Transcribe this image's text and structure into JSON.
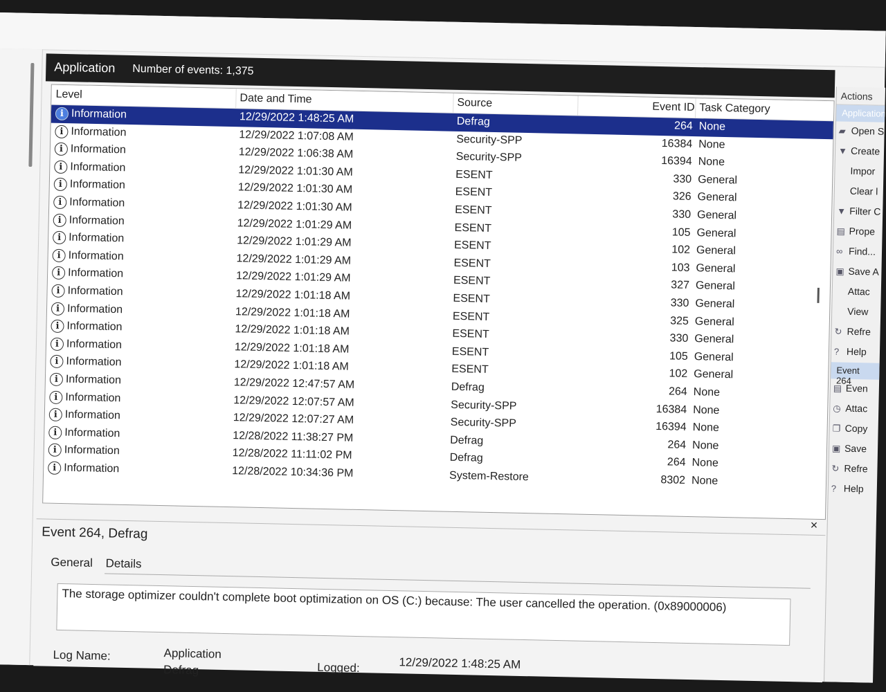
{
  "panel": {
    "title": "Application",
    "count_text": "Number of events: 1,375"
  },
  "columns": {
    "level": "Level",
    "datetime": "Date and Time",
    "source": "Source",
    "event_id": "Event ID",
    "task_category": "Task Category"
  },
  "events": [
    {
      "level": "Information",
      "datetime": "12/29/2022 1:48:25 AM",
      "source": "Defrag",
      "event_id": "264",
      "category": "None",
      "selected": true
    },
    {
      "level": "Information",
      "datetime": "12/29/2022 1:07:08 AM",
      "source": "Security-SPP",
      "event_id": "16384",
      "category": "None"
    },
    {
      "level": "Information",
      "datetime": "12/29/2022 1:06:38 AM",
      "source": "Security-SPP",
      "event_id": "16394",
      "category": "None"
    },
    {
      "level": "Information",
      "datetime": "12/29/2022 1:01:30 AM",
      "source": "ESENT",
      "event_id": "330",
      "category": "General"
    },
    {
      "level": "Information",
      "datetime": "12/29/2022 1:01:30 AM",
      "source": "ESENT",
      "event_id": "326",
      "category": "General"
    },
    {
      "level": "Information",
      "datetime": "12/29/2022 1:01:30 AM",
      "source": "ESENT",
      "event_id": "330",
      "category": "General"
    },
    {
      "level": "Information",
      "datetime": "12/29/2022 1:01:29 AM",
      "source": "ESENT",
      "event_id": "105",
      "category": "General"
    },
    {
      "level": "Information",
      "datetime": "12/29/2022 1:01:29 AM",
      "source": "ESENT",
      "event_id": "102",
      "category": "General"
    },
    {
      "level": "Information",
      "datetime": "12/29/2022 1:01:29 AM",
      "source": "ESENT",
      "event_id": "103",
      "category": "General"
    },
    {
      "level": "Information",
      "datetime": "12/29/2022 1:01:29 AM",
      "source": "ESENT",
      "event_id": "327",
      "category": "General"
    },
    {
      "level": "Information",
      "datetime": "12/29/2022 1:01:18 AM",
      "source": "ESENT",
      "event_id": "330",
      "category": "General"
    },
    {
      "level": "Information",
      "datetime": "12/29/2022 1:01:18 AM",
      "source": "ESENT",
      "event_id": "325",
      "category": "General"
    },
    {
      "level": "Information",
      "datetime": "12/29/2022 1:01:18 AM",
      "source": "ESENT",
      "event_id": "330",
      "category": "General"
    },
    {
      "level": "Information",
      "datetime": "12/29/2022 1:01:18 AM",
      "source": "ESENT",
      "event_id": "105",
      "category": "General"
    },
    {
      "level": "Information",
      "datetime": "12/29/2022 1:01:18 AM",
      "source": "ESENT",
      "event_id": "102",
      "category": "General"
    },
    {
      "level": "Information",
      "datetime": "12/29/2022 12:47:57 AM",
      "source": "Defrag",
      "event_id": "264",
      "category": "None"
    },
    {
      "level": "Information",
      "datetime": "12/29/2022 12:07:57 AM",
      "source": "Security-SPP",
      "event_id": "16384",
      "category": "None"
    },
    {
      "level": "Information",
      "datetime": "12/29/2022 12:07:27 AM",
      "source": "Security-SPP",
      "event_id": "16394",
      "category": "None"
    },
    {
      "level": "Information",
      "datetime": "12/28/2022 11:38:27 PM",
      "source": "Defrag",
      "event_id": "264",
      "category": "None"
    },
    {
      "level": "Information",
      "datetime": "12/28/2022 11:11:02 PM",
      "source": "Defrag",
      "event_id": "264",
      "category": "None"
    },
    {
      "level": "Information",
      "datetime": "12/28/2022 10:34:36 PM",
      "source": "System-Restore",
      "event_id": "8302",
      "category": "None"
    }
  ],
  "detail": {
    "title": "Event 264, Defrag",
    "tab_general": "General",
    "tab_details": "Details",
    "description": "The storage optimizer couldn't complete boot optimization on OS (C:) because: The user cancelled the operation. (0x89000006)",
    "log_name_label": "Log Name:",
    "log_name_value": "Application",
    "source_value": "Defrag",
    "logged_label": "Logged:",
    "logged_value": "12/29/2022 1:48:25 AM",
    "close_glyph": "×"
  },
  "actions": {
    "header": "Actions",
    "section1": "Application",
    "items1": [
      {
        "icon": "folder-icon",
        "glyph": "▰",
        "label": "Open S"
      },
      {
        "icon": "filter-icon",
        "glyph": "▼",
        "label": "Create"
      },
      {
        "icon": "",
        "glyph": "",
        "label": "Impor"
      },
      {
        "icon": "",
        "glyph": "",
        "label": "Clear l"
      },
      {
        "icon": "filter-icon",
        "glyph": "▼",
        "label": "Filter C"
      },
      {
        "icon": "properties-icon",
        "glyph": "▤",
        "label": "Prope"
      },
      {
        "icon": "binoculars-icon",
        "glyph": "∞",
        "label": "Find..."
      },
      {
        "icon": "save-icon",
        "glyph": "▣",
        "label": "Save A"
      },
      {
        "icon": "",
        "glyph": "",
        "label": "Attac"
      },
      {
        "icon": "",
        "glyph": "",
        "label": "View"
      },
      {
        "icon": "refresh-icon",
        "glyph": "↻",
        "label": "Refre"
      },
      {
        "icon": "help-icon",
        "glyph": "?",
        "label": "Help"
      }
    ],
    "section2": "Event 264",
    "items2": [
      {
        "icon": "event-properties-icon",
        "glyph": "▤",
        "label": "Even"
      },
      {
        "icon": "attach-task-icon",
        "glyph": "◷",
        "label": "Attac"
      },
      {
        "icon": "copy-icon",
        "glyph": "❐",
        "label": "Copy"
      },
      {
        "icon": "save-icon",
        "glyph": "▣",
        "label": "Save"
      },
      {
        "icon": "refresh-icon",
        "glyph": "↻",
        "label": "Refre"
      },
      {
        "icon": "help-icon",
        "glyph": "?",
        "label": "Help"
      }
    ]
  }
}
